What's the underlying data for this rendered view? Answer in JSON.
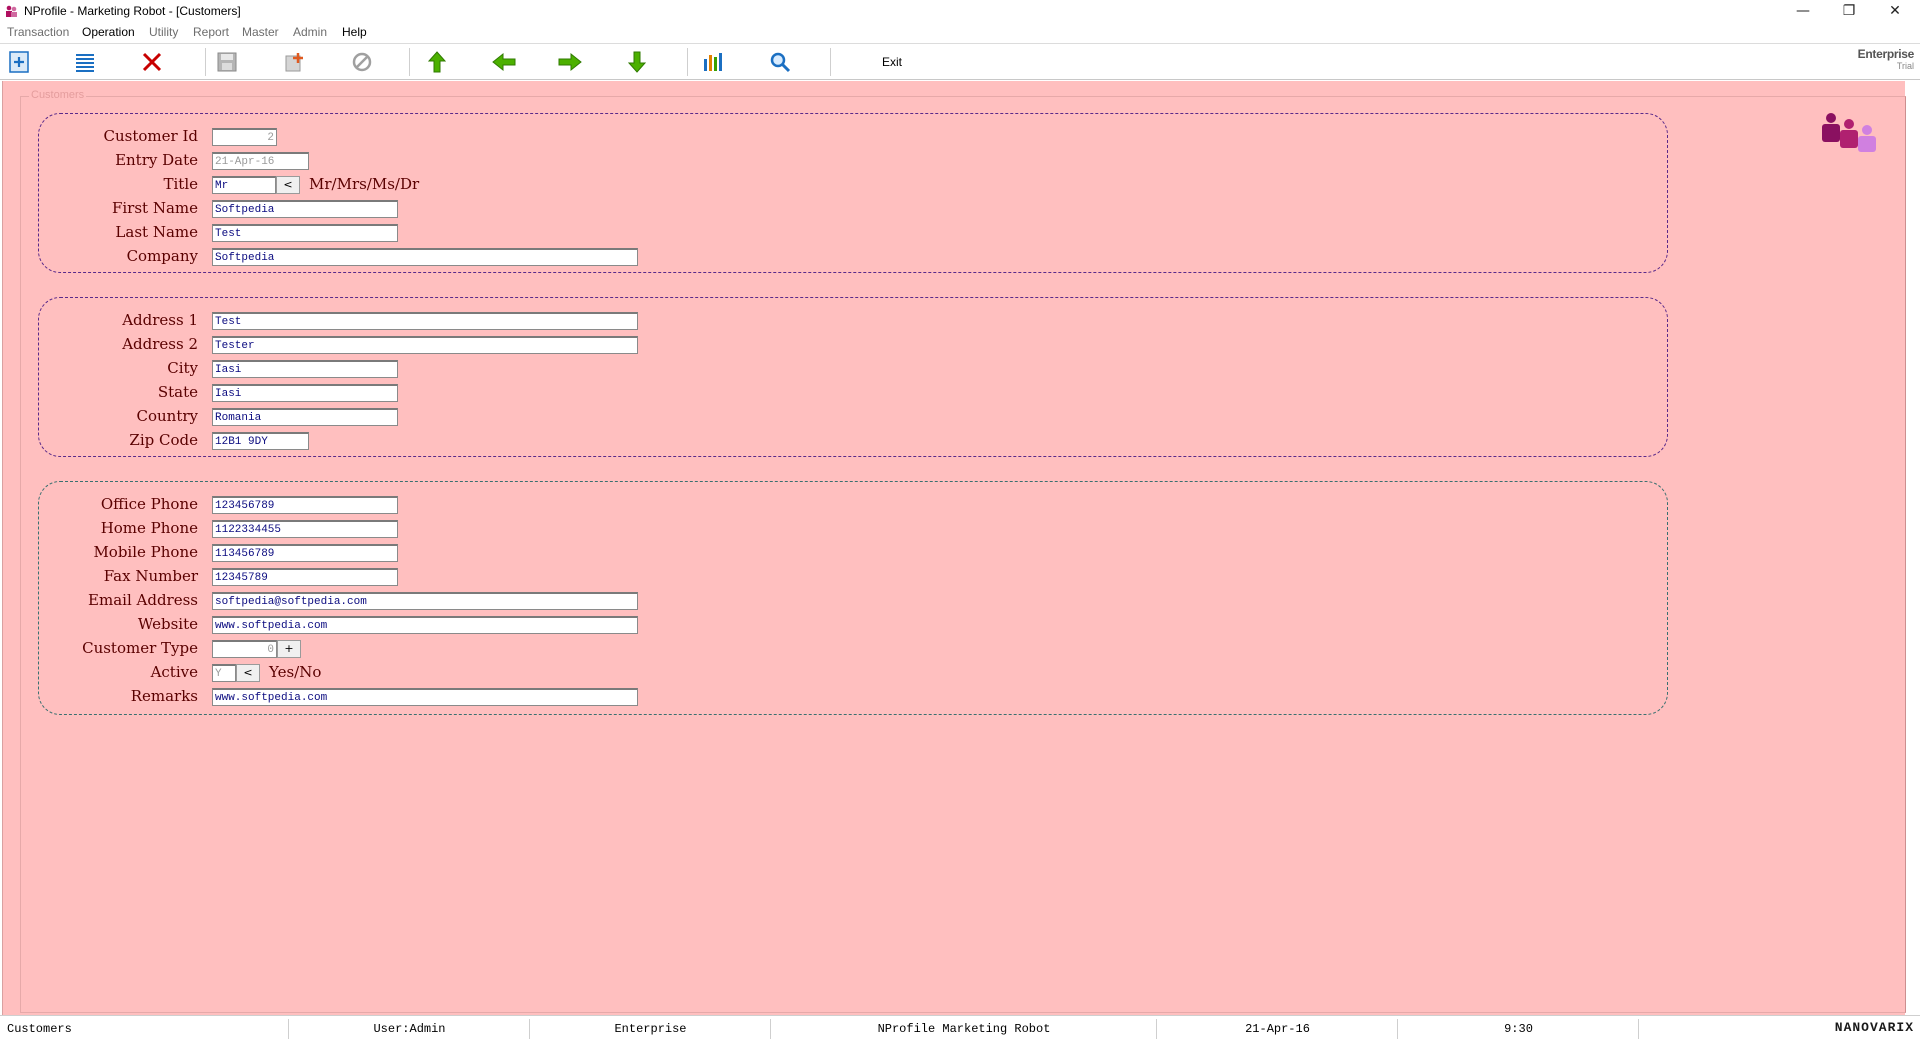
{
  "window": {
    "title": "NProfile - Marketing Robot - [Customers]",
    "controls": {
      "minimize": "—",
      "restore": "❐",
      "close": "✕"
    }
  },
  "menu": [
    "Transaction",
    "Operation",
    "Utility",
    "Report",
    "Master",
    "Admin",
    "Help"
  ],
  "toolbar": {
    "buttons": [
      {
        "name": "add-icon",
        "color": "#1b6fc2"
      },
      {
        "name": "list-icon",
        "color": "#1b6fc2"
      },
      {
        "name": "delete-icon",
        "color": "#c80000"
      },
      {
        "name": "save-icon",
        "color": "#9a9a9a"
      },
      {
        "name": "new-icon",
        "color": "#9a9a9a"
      },
      {
        "name": "cancel-icon",
        "color": "#9a9a9a"
      },
      {
        "name": "first-record-icon",
        "color": "#3aa000"
      },
      {
        "name": "previous-record-icon",
        "color": "#3aa000"
      },
      {
        "name": "next-record-icon",
        "color": "#3aa000"
      },
      {
        "name": "last-record-icon",
        "color": "#3aa000"
      },
      {
        "name": "chart-icon",
        "color": "#1b6fc2"
      },
      {
        "name": "search-icon",
        "color": "#1b6fc2"
      }
    ],
    "exit_label": "Exit",
    "edition": "Enterprise",
    "edition_sub": "Trial"
  },
  "form": {
    "legend": "Customers",
    "customer_id": {
      "label": "Customer Id",
      "value": "2"
    },
    "entry_date": {
      "label": "Entry Date",
      "value": "21-Apr-16"
    },
    "title": {
      "label": "Title",
      "value": "Mr",
      "button": "<",
      "hint": "Mr/Mrs/Ms/Dr"
    },
    "first_name": {
      "label": "First Name",
      "value": "Softpedia"
    },
    "last_name": {
      "label": "Last Name",
      "value": "Test"
    },
    "company": {
      "label": "Company",
      "value": "Softpedia"
    },
    "address1": {
      "label": "Address 1",
      "value": "Test"
    },
    "address2": {
      "label": "Address 2",
      "value": "Tester"
    },
    "city": {
      "label": "City",
      "value": "Iasi"
    },
    "state": {
      "label": "State",
      "value": "Iasi"
    },
    "country": {
      "label": "Country",
      "value": "Romania"
    },
    "zip": {
      "label": "Zip Code",
      "value": "12B1 9DY"
    },
    "office_phone": {
      "label": "Office Phone",
      "value": "123456789"
    },
    "home_phone": {
      "label": "Home Phone",
      "value": "1122334455"
    },
    "mobile_phone": {
      "label": "Mobile Phone",
      "value": "113456789"
    },
    "fax": {
      "label": "Fax Number",
      "value": "12345789"
    },
    "email": {
      "label": "Email Address",
      "value": "softpedia@softpedia.com"
    },
    "website": {
      "label": "Website",
      "value": "www.softpedia.com"
    },
    "customer_type": {
      "label": "Customer Type",
      "value": "0",
      "button": "+"
    },
    "active": {
      "label": "Active",
      "value": "Y",
      "button": "<",
      "hint": "Yes/No"
    },
    "remarks": {
      "label": "Remarks",
      "value": "www.softpedia.com"
    }
  },
  "status": {
    "module": "Customers",
    "user": "User:Admin",
    "edition": "Enterprise",
    "product": "NProfile Marketing Robot",
    "date": "21-Apr-16",
    "time": "9:30",
    "brand": "NANOVARIX"
  }
}
